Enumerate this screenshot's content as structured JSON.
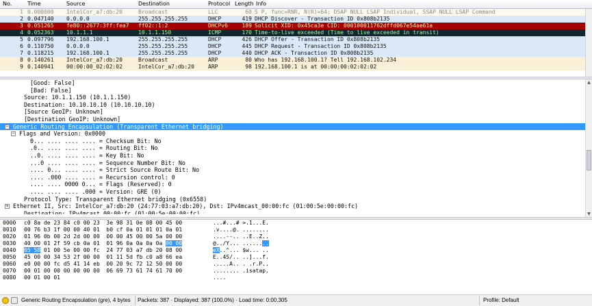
{
  "colors": {
    "llc": "#fbf8ed",
    "dhcp": "#dbe8f7",
    "dhcpv6_selected": "#a40000",
    "icmp_error": "#12272e",
    "arp": "#faf0d7",
    "selection": "#3399ff"
  },
  "packet_list": {
    "columns": [
      "No.",
      "Time",
      "Source",
      "Destination",
      "Protocol",
      "Length",
      "Info"
    ],
    "rows": [
      {
        "no": "1",
        "time": "0.000000",
        "src": "IntelCor_a7:db:20",
        "dst": "Broadcast",
        "proto": "LLC",
        "len": "60",
        "info": "S P, func=RNR, N(R)=64; DSAP NULL LSAP Individual, SSAP NULL LSAP Command",
        "bg": "#fbf8ed",
        "fg": "#8a8a8a"
      },
      {
        "no": "2",
        "time": "0.047140",
        "src": "0.0.0.0",
        "dst": "255.255.255.255",
        "proto": "DHCP",
        "len": "419",
        "info": "DHCP Discover  - Transaction ID 0x808b2135",
        "bg": "#dbe8f7",
        "fg": "#111111"
      },
      {
        "no": "3",
        "time": "0.051265",
        "src": "fe80::2677:3ff:fea7",
        "dst": "ff02::1:2",
        "proto": "DHCPv6",
        "len": "189",
        "info": "Solicit XID: 0x45ca3e CID: 000100011762dffd067e54ae61a",
        "bg": "#a40000",
        "fg": "#fff2a8"
      },
      {
        "no": "4",
        "time": "0.052363",
        "src": "10.1.1.1",
        "dst": "10.1.1.150",
        "proto": "ICMP",
        "len": "170",
        "info": "Time-to-live exceeded (Time to live exceeded in transit)",
        "bg": "#12272e",
        "fg": "#9ff7a0"
      },
      {
        "no": "5",
        "time": "0.097796",
        "src": "192.168.100.1",
        "dst": "255.255.255.255",
        "proto": "DHCP",
        "len": "426",
        "info": "DHCP Offer    - Transaction ID 0x808b2135",
        "bg": "#dbe8f7",
        "fg": "#111111"
      },
      {
        "no": "6",
        "time": "0.110750",
        "src": "0.0.0.0",
        "dst": "255.255.255.255",
        "proto": "DHCP",
        "len": "445",
        "info": "DHCP Request  - Transaction ID 0x808b2135",
        "bg": "#dbe8f7",
        "fg": "#111111"
      },
      {
        "no": "7",
        "time": "0.118215",
        "src": "192.168.100.1",
        "dst": "255.255.255.255",
        "proto": "DHCP",
        "len": "440",
        "info": "DHCP ACK      - Transaction ID 0x808b2135",
        "bg": "#dbe8f7",
        "fg": "#111111"
      },
      {
        "no": "8",
        "time": "0.140261",
        "src": "IntelCor_a7:db:20",
        "dst": "Broadcast",
        "proto": "ARP",
        "len": "80",
        "info": "Who has 192.168.100.1?  Tell 192.168.102.234",
        "bg": "#faf0d7",
        "fg": "#111111"
      },
      {
        "no": "9",
        "time": "0.140941",
        "src": "00:00:00_02:02:02",
        "dst": "IntelCor_a7:db:20",
        "proto": "ARP",
        "len": "98",
        "info": "192.168.100.1 is at 00:00:00:02:02:02",
        "bg": "#faf0d7",
        "fg": "#111111"
      }
    ]
  },
  "details": {
    "lines": [
      {
        "indent": 4,
        "text": "[Good: False]",
        "toggle": ""
      },
      {
        "indent": 4,
        "text": "[Bad: False]",
        "toggle": ""
      },
      {
        "indent": 3,
        "text": "Source: 10.1.1.150 (10.1.1.150)",
        "toggle": ""
      },
      {
        "indent": 3,
        "text": "Destination: 10.10.10.10 (10.10.10.10)",
        "toggle": ""
      },
      {
        "indent": 3,
        "text": "[Source GeoIP: Unknown]",
        "toggle": ""
      },
      {
        "indent": 3,
        "text": "[Destination GeoIP: Unknown]",
        "toggle": ""
      },
      {
        "indent": 1,
        "text": "Generic Routing Encapsulation (Transparent Ethernet bridging)",
        "toggle": "−",
        "selected": true
      },
      {
        "indent": 2,
        "text": "Flags and Version: 0x0000",
        "toggle": "−"
      },
      {
        "indent": 4,
        "text": "0... .... .... .... = Checksum Bit: No",
        "toggle": ""
      },
      {
        "indent": 4,
        "text": ".0.. .... .... .... = Routing Bit: No",
        "toggle": ""
      },
      {
        "indent": 4,
        "text": "..0. .... .... .... = Key Bit: No",
        "toggle": ""
      },
      {
        "indent": 4,
        "text": "...0 .... .... .... = Sequence Number Bit: No",
        "toggle": ""
      },
      {
        "indent": 4,
        "text": ".... 0... .... .... = Strict Source Route Bit: No",
        "toggle": ""
      },
      {
        "indent": 4,
        "text": ".... .000 .... .... = Recursion control: 0",
        "toggle": ""
      },
      {
        "indent": 4,
        "text": ".... .... 0000 0... = Flags (Reserved): 0",
        "toggle": ""
      },
      {
        "indent": 4,
        "text": ".... .... .... .000 = Version: GRE (0)",
        "toggle": ""
      },
      {
        "indent": 3,
        "text": "Protocol Type: Transparent Ethernet bridging (0x6558)",
        "toggle": ""
      },
      {
        "indent": 1,
        "text": "Ethernet II, Src: IntelCor_a7:db:20 (24:77:03:a7:db:20), Dst: IPv4mcast_00:00:fc (01:00:5e:00:00:fc)",
        "toggle": "+"
      },
      {
        "indent": 3,
        "text": "Destination: IPv4mcast_00:00:fc (01:00:5e:00:00:fc)",
        "toggle": "",
        "cut": true
      }
    ]
  },
  "hex_dump": {
    "rows": [
      {
        "offset": "0000",
        "bytes": "c0 8a de 23 84 c0 00 23  3e 98 31 0e 08 00 45 00",
        "ascii": "...#...# >.1...E."
      },
      {
        "offset": "0010",
        "bytes": "00 76 b3 1f 00 00 40 01  b0 cf 0a 01 01 01 0a 01",
        "ascii": ".v....@. ........"
      },
      {
        "offset": "0020",
        "bytes": "01 96 0b 00 2d 2d 00 00  00 00 45 00 00 5a 00 00",
        "ascii": "....--.. ..E..Z.."
      },
      {
        "offset": "0030",
        "bytes": "40 00 01 2f 59 cb 0a 01  01 96 0a 0a 0a 0a 00 00",
        "ascii": "@../Y... ........"
      },
      {
        "offset": "0040",
        "bytes": "65 58 01 00 5e 00 00 fc  24 77 03 a7 db 20 08 00",
        "ascii": "eX..^... $w... .."
      },
      {
        "offset": "0050",
        "bytes": "45 00 00 34 53 2f 00 00  01 11 5d fb c0 a8 66 ea",
        "ascii": "E..4S/.. ..]...f."
      },
      {
        "offset": "0060",
        "bytes": "e0 00 00 fc d5 41 14 eb  00 20 9c 72 12 50 00 00",
        "ascii": ".....A.. . .r.P.."
      },
      {
        "offset": "0070",
        "bytes": "00 01 00 00 00 00 00 00  06 69 73 61 74 61 70 00",
        "ascii": "........ .isatap."
      },
      {
        "offset": "0080",
        "bytes": "00 01 00 01",
        "ascii": "...."
      }
    ]
  },
  "status_bar": {
    "field": "Generic Routing Encapsulation (gre), 4 bytes",
    "packets": "Packets: 387 · Displayed: 387 (100.0%) · Load time: 0:00.305",
    "profile": "Profile: Default"
  }
}
